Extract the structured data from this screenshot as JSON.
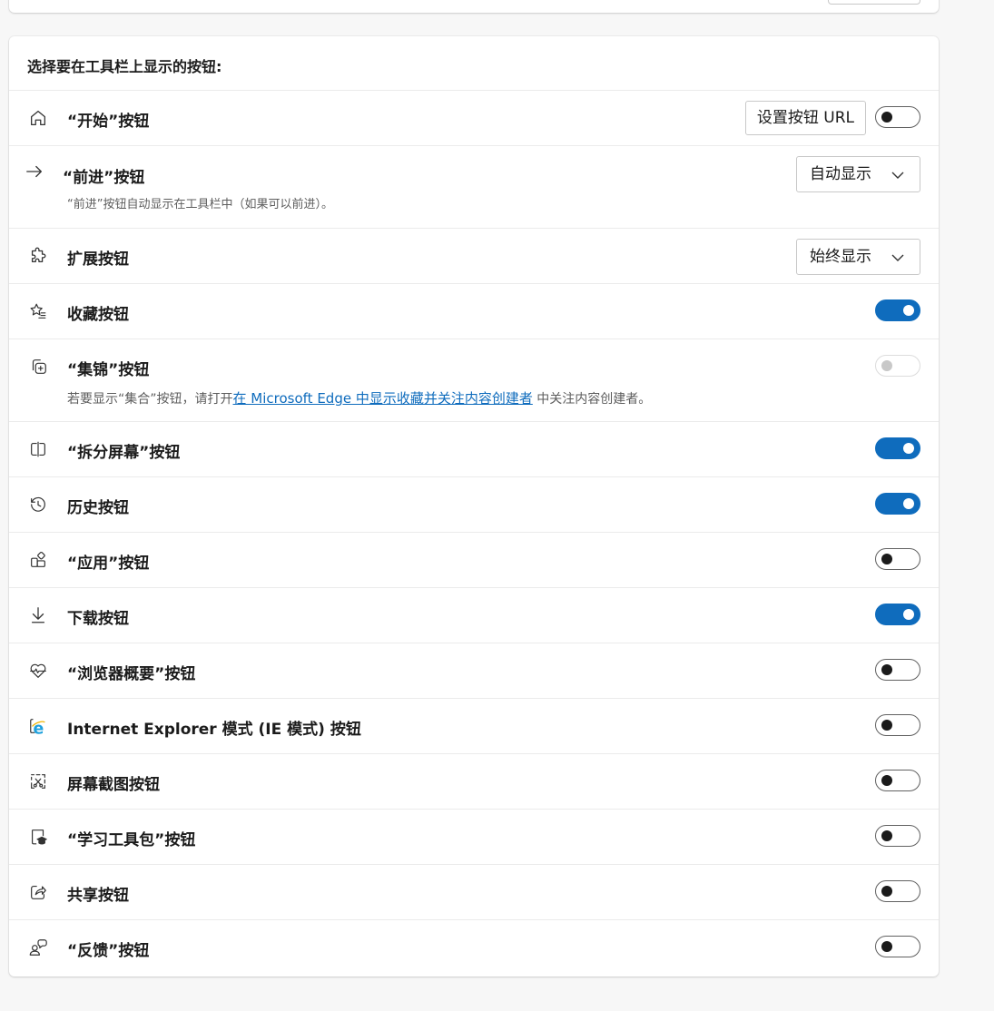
{
  "section_title": "选择要在工具栏上显示的按钮:",
  "rows": [
    {
      "label": "“开始”按钮",
      "icon": "home-icon",
      "button": "设置按钮 URL",
      "toggle": "off"
    },
    {
      "label": "“前进”按钮",
      "icon": "forward-arrow-icon",
      "select": "自动显示",
      "description": "“前进”按钮自动显示在工具栏中（如果可以前进）。"
    },
    {
      "label": "扩展按钮",
      "icon": "extensions-icon",
      "select": "始终显示"
    },
    {
      "label": "收藏按钮",
      "icon": "favorites-icon",
      "toggle": "on"
    },
    {
      "label": "“集锦”按钮",
      "icon": "collections-icon",
      "toggle": "disabled",
      "description_prefix": "若要显示“集合”按钮，请打开",
      "description_link": "在 Microsoft Edge 中显示收藏并关注内容创建者",
      "description_suffix": " 中关注内容创建者。"
    },
    {
      "label": "“拆分屏幕”按钮",
      "icon": "split-screen-icon",
      "toggle": "on"
    },
    {
      "label": "历史按钮",
      "icon": "history-icon",
      "toggle": "on"
    },
    {
      "label": "“应用”按钮",
      "icon": "apps-icon",
      "toggle": "off"
    },
    {
      "label": "下载按钮",
      "icon": "download-icon",
      "toggle": "on"
    },
    {
      "label": "“浏览器概要”按钮",
      "icon": "browser-essentials-icon",
      "toggle": "off"
    },
    {
      "label": "Internet Explorer 模式 (IE 模式) 按钮",
      "icon": "ie-mode-icon",
      "toggle": "off"
    },
    {
      "label": "屏幕截图按钮",
      "icon": "screenshot-icon",
      "toggle": "off"
    },
    {
      "label": "“学习工具包”按钮",
      "icon": "learning-toolkit-icon",
      "toggle": "off"
    },
    {
      "label": "共享按钮",
      "icon": "share-icon",
      "toggle": "off"
    },
    {
      "label": "“反馈”按钮",
      "icon": "feedback-icon",
      "toggle": "off"
    }
  ],
  "colors": {
    "accent": "#0f6cbd",
    "ie_blue": "#1ea0dc"
  }
}
